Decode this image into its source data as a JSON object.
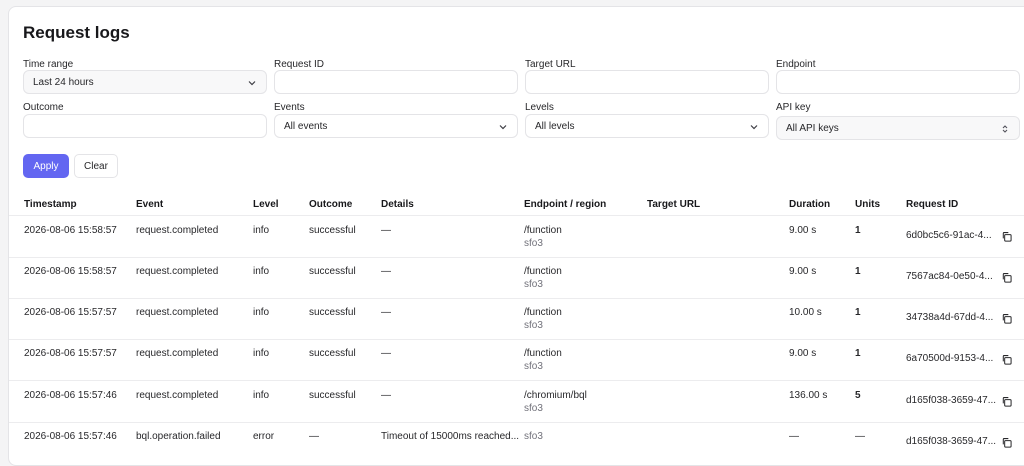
{
  "page": {
    "title": "Request logs"
  },
  "filters": {
    "time_range": {
      "label": "Time range",
      "value": "Last 24 hours"
    },
    "request_id": {
      "label": "Request ID",
      "value": ""
    },
    "target_url": {
      "label": "Target URL",
      "value": ""
    },
    "endpoint": {
      "label": "Endpoint",
      "value": ""
    },
    "outcome": {
      "label": "Outcome",
      "value": ""
    },
    "events": {
      "label": "Events",
      "value": "All events"
    },
    "levels": {
      "label": "Levels",
      "value": "All levels"
    },
    "api_key": {
      "label": "API key",
      "value": "All API keys"
    }
  },
  "actions": {
    "apply": "Apply",
    "clear": "Clear"
  },
  "table": {
    "columns": [
      "Timestamp",
      "Event",
      "Level",
      "Outcome",
      "Details",
      "Endpoint / region",
      "Target URL",
      "Duration",
      "Units",
      "Request ID"
    ],
    "rows": [
      {
        "timestamp": "2026-08-06 15:58:57",
        "event": "request.completed",
        "level": "info",
        "outcome": "successful",
        "details": "—",
        "endpoint": "/function",
        "region": "sfo3",
        "target_url": "",
        "duration": "9.00 s",
        "units": "1",
        "request_id": "6d0bc5c6-91ac-4..."
      },
      {
        "timestamp": "2026-08-06 15:58:57",
        "event": "request.completed",
        "level": "info",
        "outcome": "successful",
        "details": "—",
        "endpoint": "/function",
        "region": "sfo3",
        "target_url": "",
        "duration": "9.00 s",
        "units": "1",
        "request_id": "7567ac84-0e50-4..."
      },
      {
        "timestamp": "2026-08-06 15:57:57",
        "event": "request.completed",
        "level": "info",
        "outcome": "successful",
        "details": "—",
        "endpoint": "/function",
        "region": "sfo3",
        "target_url": "",
        "duration": "10.00 s",
        "units": "1",
        "request_id": "34738a4d-67dd-4..."
      },
      {
        "timestamp": "2026-08-06 15:57:57",
        "event": "request.completed",
        "level": "info",
        "outcome": "successful",
        "details": "—",
        "endpoint": "/function",
        "region": "sfo3",
        "target_url": "",
        "duration": "9.00 s",
        "units": "1",
        "request_id": "6a70500d-9153-4..."
      },
      {
        "timestamp": "2026-08-06 15:57:46",
        "event": "request.completed",
        "level": "info",
        "outcome": "successful",
        "details": "—",
        "endpoint": "/chromium/bql",
        "region": "sfo3",
        "target_url": "",
        "duration": "136.00 s",
        "units": "5",
        "request_id": "d165f038-3659-47..."
      },
      {
        "timestamp": "2026-08-06 15:57:46",
        "event": "bql.operation.failed",
        "level": "error",
        "outcome": "—",
        "details": "Timeout of 15000ms reached...",
        "endpoint": "",
        "region": "sfo3",
        "target_url": "",
        "duration": "—",
        "units": "—",
        "request_id": "d165f038-3659-47..."
      }
    ]
  },
  "colors": {
    "accent": "#6366f1",
    "border": "#e4e4e7",
    "muted_text": "#71717a"
  },
  "icons": {
    "select_chevron": "chevron-down-icon",
    "select_updown": "chevrons-up-down-icon",
    "copy": "copy-icon"
  }
}
